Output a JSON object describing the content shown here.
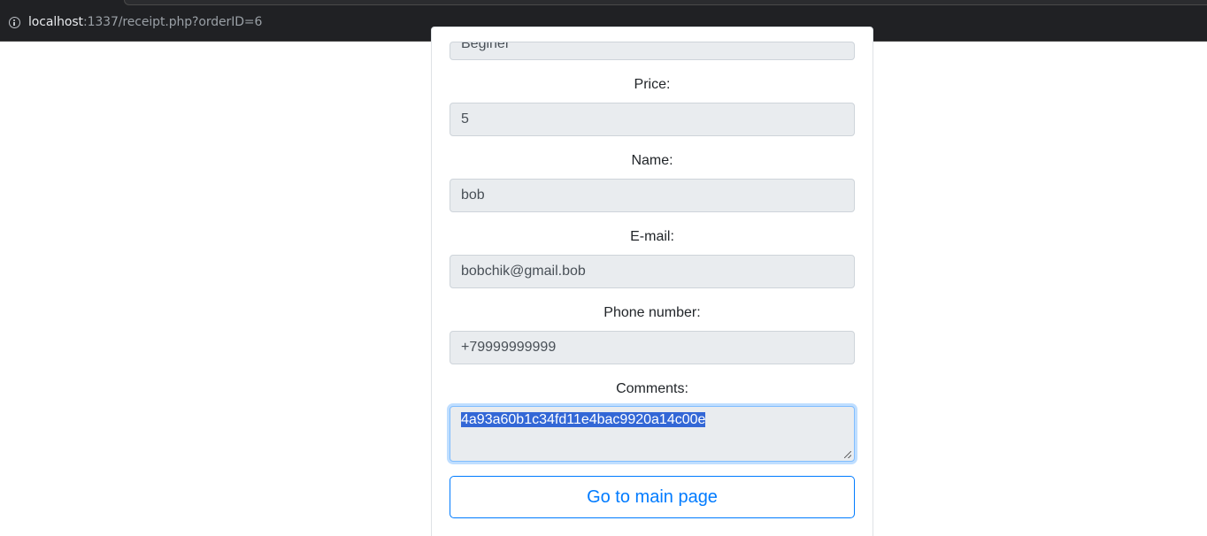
{
  "browser": {
    "url_host": "localhost",
    "url_path": ":1337/receipt.php?orderID=6"
  },
  "form": {
    "level_value": "Beginer",
    "price_label": "Price:",
    "price_value": "5",
    "name_label": "Name:",
    "name_value": "bob",
    "email_label": "E-mail:",
    "email_value": "bobchik@gmail.bob",
    "phone_label": "Phone number:",
    "phone_value": "+79999999999",
    "comments_label": "Comments:",
    "comments_value": "4a93a60b1c34fd11e4bac9920a14c00e"
  },
  "actions": {
    "main_page_label": "Go to main page"
  },
  "colors": {
    "accent": "#007bff",
    "selection": "#3367d6",
    "input_bg": "#e9ecef"
  }
}
